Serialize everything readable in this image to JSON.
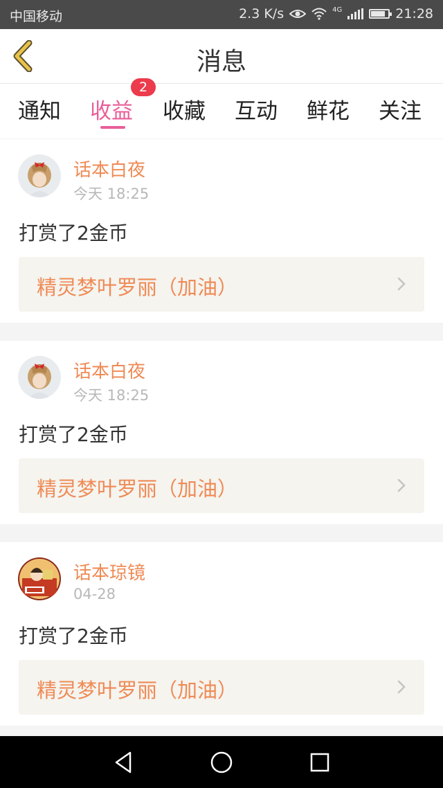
{
  "status_bar": {
    "carrier": "中国移动",
    "speed": "2.3 K/s",
    "network": "4G",
    "time": "21:28",
    "battery_level": 0.85
  },
  "header": {
    "title": "消息",
    "back_icon": "chevron-left-icon",
    "accent": "#e8c24a"
  },
  "tabs": [
    {
      "label": "通知"
    },
    {
      "label": "收益",
      "active": true,
      "badge": "2"
    },
    {
      "label": "收藏"
    },
    {
      "label": "互动"
    },
    {
      "label": "鲜花"
    },
    {
      "label": "关注"
    }
  ],
  "messages": [
    {
      "user": "话本白夜",
      "time": "今天 18:25",
      "text": "打赏了2金币",
      "link": "精灵梦叶罗丽（加油）",
      "avatar": "girl-avatar"
    },
    {
      "user": "话本白夜",
      "time": "今天 18:25",
      "text": "打赏了2金币",
      "link": "精灵梦叶罗丽（加油）",
      "avatar": "girl-avatar"
    },
    {
      "user": "话本琼镜",
      "time": "04-28",
      "text": "打赏了2金币",
      "link": "精灵梦叶罗丽（加油）",
      "avatar": "character-avatar"
    }
  ],
  "colors": {
    "accent_pink": "#e95e99",
    "name_orange": "#ef8a55",
    "badge_red": "#ec3b4d"
  },
  "nav": [
    "back-triangle-icon",
    "home-circle-icon",
    "recents-square-icon"
  ]
}
